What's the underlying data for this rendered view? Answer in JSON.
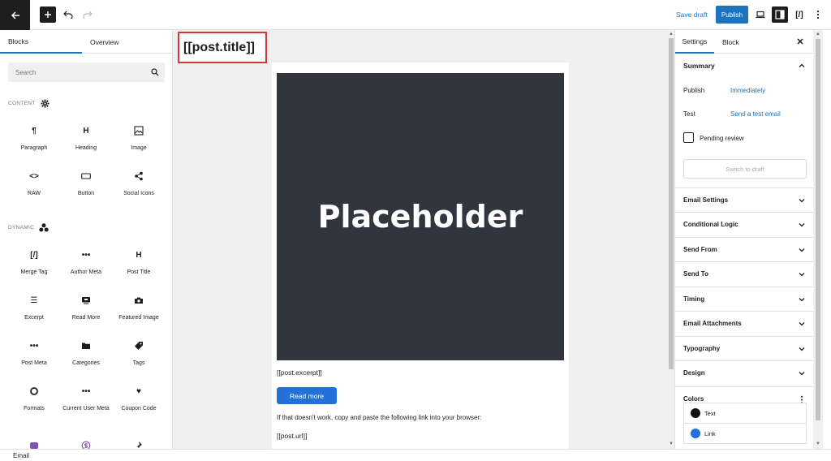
{
  "toolbar": {
    "save_draft": "Save draft",
    "publish": "Publish",
    "merge_tag": "[/]"
  },
  "left_panel": {
    "tabs": [
      "Blocks",
      "Overview"
    ],
    "search_placeholder": "Search",
    "content_label": "CONTENT",
    "dynamic_label": "DYNAMIC",
    "content_blocks": [
      {
        "label": "Paragraph",
        "icon": "paragraph-icon",
        "glyph": "¶"
      },
      {
        "label": "Heading",
        "icon": "heading-icon",
        "glyph": "H"
      },
      {
        "label": "Image",
        "icon": "image-icon",
        "glyph": ""
      },
      {
        "label": "RAW",
        "icon": "code-icon",
        "glyph": "<>"
      },
      {
        "label": "Button",
        "icon": "button-icon",
        "glyph": ""
      },
      {
        "label": "Social Icons",
        "icon": "share-icon",
        "glyph": ""
      }
    ],
    "dynamic_blocks": [
      {
        "label": "Merge Tag",
        "icon": "merge-tag-icon",
        "glyph": "[/]"
      },
      {
        "label": "Author Meta",
        "icon": "ellipsis-icon",
        "glyph": "•••"
      },
      {
        "label": "Post Title",
        "icon": "heading-icon",
        "glyph": "H"
      },
      {
        "label": "Excerpt",
        "icon": "excerpt-icon",
        "glyph": "☰"
      },
      {
        "label": "Read More",
        "icon": "read-more-icon",
        "glyph": ""
      },
      {
        "label": "Featured Image",
        "icon": "camera-icon",
        "glyph": ""
      },
      {
        "label": "Post Meta",
        "icon": "ellipsis-icon",
        "glyph": "•••"
      },
      {
        "label": "Categories",
        "icon": "folder-icon",
        "glyph": ""
      },
      {
        "label": "Tags",
        "icon": "tag-icon",
        "glyph": ""
      },
      {
        "label": "Formats",
        "icon": "circle-icon",
        "glyph": ""
      },
      {
        "label": "Current User Meta",
        "icon": "ellipsis-icon",
        "glyph": "•••"
      },
      {
        "label": "Coupon Code",
        "icon": "heart-icon",
        "glyph": "♥"
      }
    ]
  },
  "canvas": {
    "title": "[[post.title]]",
    "placeholder": "Placeholder",
    "excerpt": "[[post.excerpt]]",
    "read_more": "Read more",
    "fallback_text": "If that doesn't work, copy and paste the following link into your browser:",
    "post_url": "[[post.url]]"
  },
  "right_panel": {
    "tabs": [
      "Settings",
      "Block"
    ],
    "summary": "Summary",
    "publish_label": "Publish",
    "publish_value": "Immediately",
    "test_label": "Test",
    "test_value": "Send a test email",
    "pending_review": "Pending review",
    "switch_to_draft": "Switch to draft",
    "sections": [
      "Email Settings",
      "Conditional Logic",
      "Send From",
      "Send To",
      "Timing",
      "Email Attachments",
      "Typography",
      "Design"
    ],
    "colors": "Colors",
    "color_items": [
      {
        "label": "Text",
        "color": "#111111"
      },
      {
        "label": "Link",
        "color": "#2271d8"
      }
    ]
  },
  "footer": {
    "breadcrumb": "Email"
  },
  "colors": {
    "accent": "#1e73be",
    "placeholder_bg": "#31353d",
    "title_border": "#d63638"
  }
}
